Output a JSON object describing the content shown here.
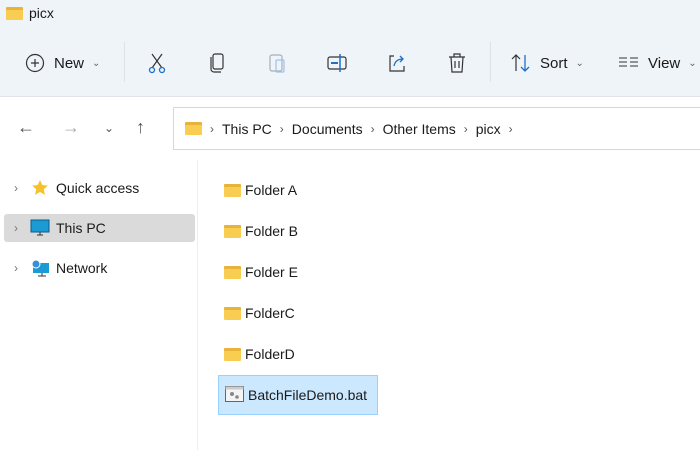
{
  "window": {
    "title": "picx"
  },
  "toolbar": {
    "new_label": "New",
    "sort_label": "Sort",
    "view_label": "View"
  },
  "address": {
    "crumbs": [
      "This PC",
      "Documents",
      "Other Items",
      "picx"
    ]
  },
  "sidebar": {
    "items": [
      {
        "label": "Quick access"
      },
      {
        "label": "This PC"
      },
      {
        "label": "Network"
      }
    ]
  },
  "files": [
    {
      "name": "Folder A"
    },
    {
      "name": "Folder B"
    },
    {
      "name": "Folder E"
    },
    {
      "name": "FolderC"
    },
    {
      "name": "FolderD"
    },
    {
      "name": "BatchFileDemo.bat"
    }
  ]
}
